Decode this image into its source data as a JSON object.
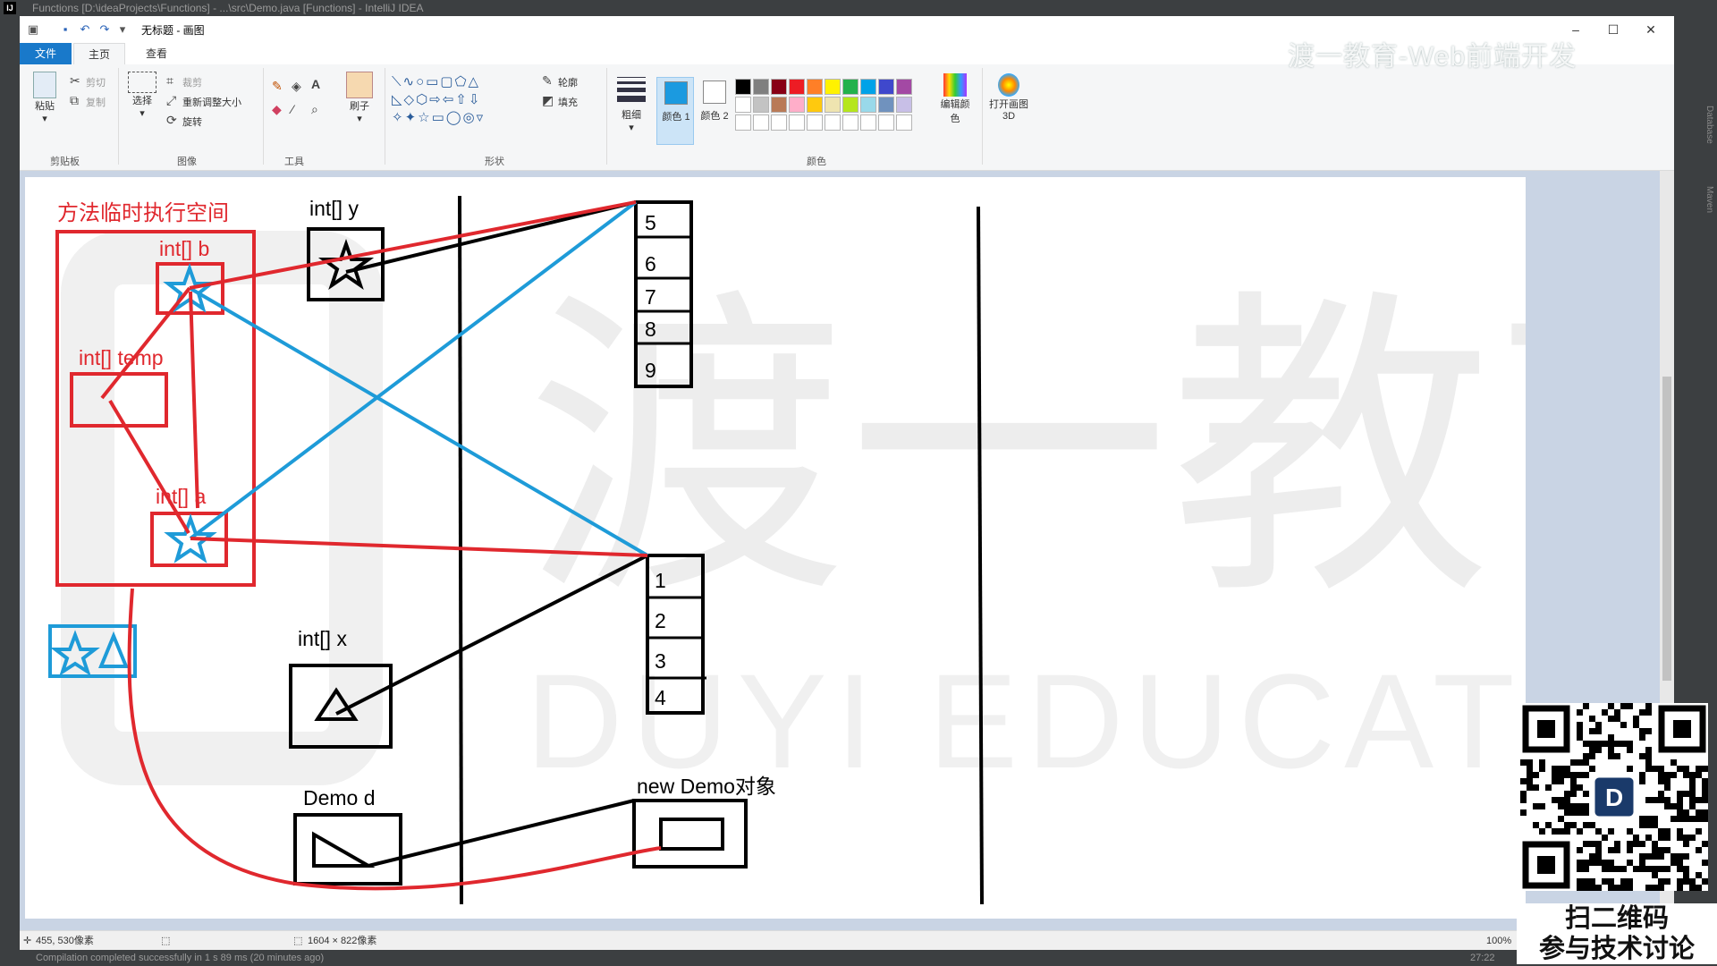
{
  "ide": {
    "title": "Functions [D:\\ideaProjects\\Functions] - ...\\src\\Demo.java [Functions] - IntelliJ IDEA",
    "status_message": "Compilation completed successfully in 1 s 89 ms (20 minutes ago)",
    "status_time": "27:22",
    "side_labels": [
      "Database",
      "Maven"
    ]
  },
  "paint": {
    "window_title": "无标题 - 画图",
    "tabs": {
      "file": "文件",
      "home": "主页",
      "view": "查看"
    },
    "clipboard": {
      "paste": "粘贴",
      "cut": "剪切",
      "copy": "复制",
      "group": "剪贴板"
    },
    "image": {
      "select": "选择",
      "crop": "裁剪",
      "resize": "重新调整大小",
      "rotate": "旋转",
      "group": "图像"
    },
    "tools_group": "工具",
    "brushes_label": "刷子",
    "shapes": {
      "outline": "轮廓",
      "fill": "填充",
      "group": "形状"
    },
    "size_label": "粗细",
    "color1_label": "颜色 1",
    "color2_label": "颜色 2",
    "edit_colors_label": "编辑颜色",
    "paint3d_label": "打开画图 3D",
    "colors_group": "颜色",
    "colors": {
      "color1": "#1b9ae0",
      "color2": "#ffffff",
      "palette_row1": [
        "#000000",
        "#7f7f7f",
        "#880015",
        "#ed1c24",
        "#ff7f27",
        "#fff200",
        "#22b14c",
        "#00a2e8",
        "#3f48cc",
        "#a349a4"
      ],
      "palette_row2": [
        "#ffffff",
        "#c3c3c3",
        "#b97a57",
        "#ffaec9",
        "#ffc90e",
        "#efe4b0",
        "#b5e61d",
        "#99d9ea",
        "#7092be",
        "#c8bfe7"
      ]
    },
    "statusbar": {
      "cursor_pos": "455, 530像素",
      "canvas_size": "1604 × 822像素",
      "zoom": "100%"
    }
  },
  "drawing": {
    "method_space_label": "方法临时执行空间",
    "var_b": "int[] b",
    "var_temp": "int[] temp",
    "var_a": "int[] a",
    "var_y": "int[] y",
    "var_x": "int[] x",
    "var_d": "Demo d",
    "new_obj": "new Demo对象",
    "array_top": [
      "5",
      "6",
      "7",
      "8",
      "9"
    ],
    "array_bottom": [
      "1",
      "2",
      "3",
      "4"
    ],
    "watermark_cn": "渡一教育",
    "watermark_en": "DUYI EDUCATION",
    "stroke_colors": {
      "red": "#e0282e",
      "blue": "#1e9bd8",
      "black": "#000000"
    }
  },
  "overlay": {
    "brand": "渡一教育-Web前端开发",
    "qr_caption_1": "扫二维码",
    "qr_caption_2": "参与技术讨论"
  }
}
